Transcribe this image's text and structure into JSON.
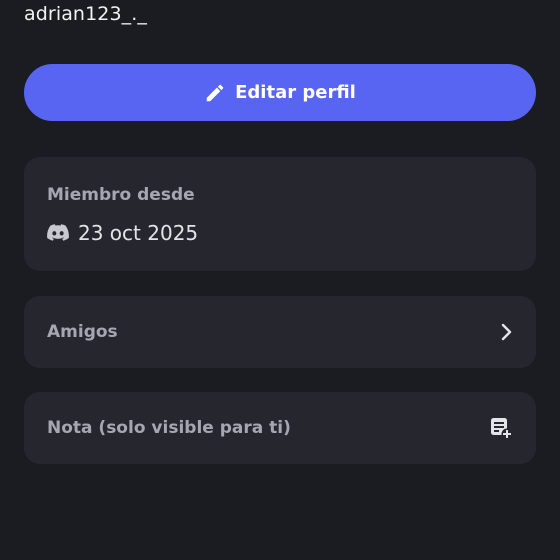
{
  "profile": {
    "username": "adrian123_._"
  },
  "edit_button": {
    "label": "Editar perfil",
    "icon": "pencil-icon",
    "color": "#5865f2"
  },
  "member_card": {
    "label": "Miembro desde",
    "icon": "discord-icon",
    "date": "23 oct 2025"
  },
  "friends_row": {
    "label": "Amigos",
    "icon": "chevron-right-icon"
  },
  "note_row": {
    "label": "Nota (solo visible para ti)",
    "icon": "note-add-icon"
  },
  "colors": {
    "background": "#1b1c21",
    "card": "#26272e",
    "accent": "#5865f2"
  }
}
